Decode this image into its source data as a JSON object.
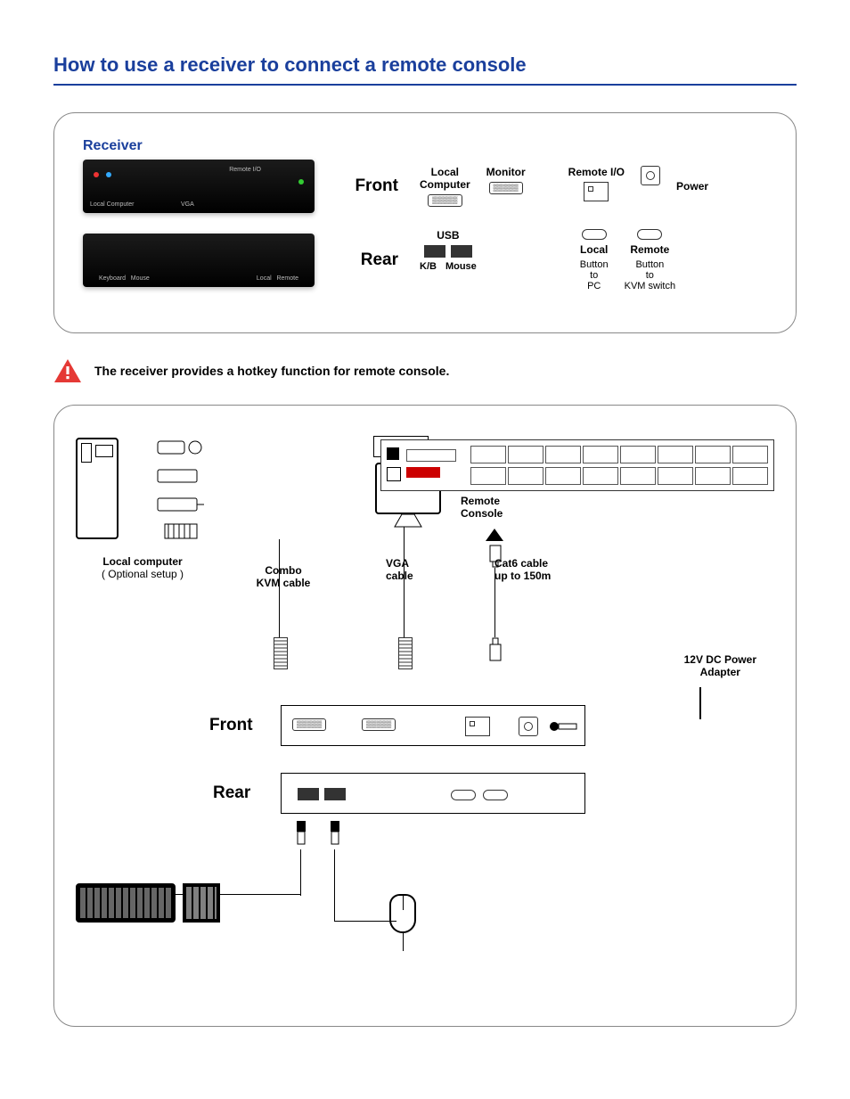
{
  "title": "How to use a receiver to connect a remote console",
  "panel1": {
    "heading": "Receiver",
    "front_label": "Front",
    "rear_label": "Rear",
    "front_ports": {
      "local_computer": "Local\nComputer",
      "monitor": "Monitor",
      "remote_io": "Remote I/O",
      "power": "Power"
    },
    "rear_ports": {
      "usb": "USB",
      "kb": "K/B",
      "mouse": "Mouse",
      "local": "Local",
      "remote": "Remote",
      "button_to_pc": "Button\nto\nPC",
      "button_to_kvm": "Button\nto\nKVM switch"
    }
  },
  "note": "The receiver provides a hotkey function for remote console.",
  "panel2": {
    "local_computer": "Local computer",
    "optional": "( Optional setup )",
    "combo_cable": "Combo\nKVM cable",
    "monitor": "Monitor",
    "vga_cable": "VGA\ncable",
    "remote_console": "Remote\nConsole",
    "cat6": "Cat6 cable\nup to 150m",
    "power_adapter": "12V DC Power\nAdapter",
    "front": "Front",
    "rear": "Rear"
  }
}
